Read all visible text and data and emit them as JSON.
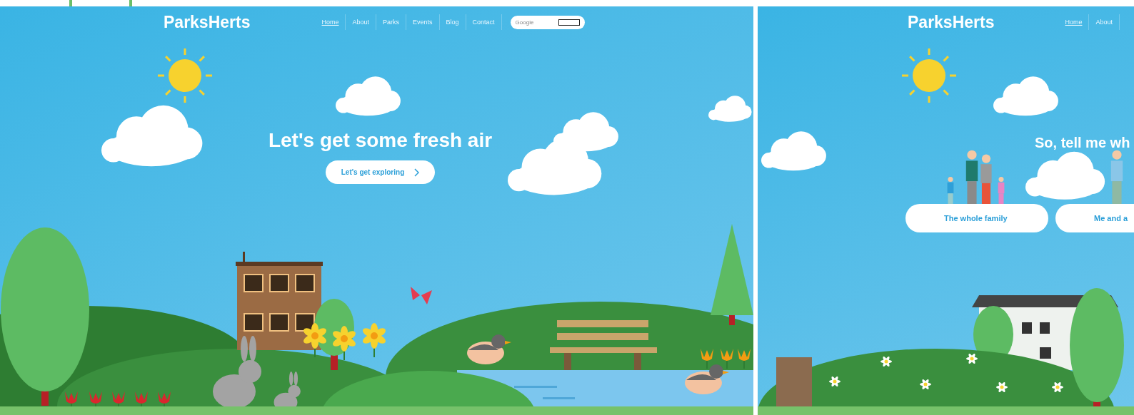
{
  "pages": [
    {
      "kind": "landing",
      "logo": "ParksHerts",
      "nav": [
        {
          "label": "Home",
          "selected": true
        },
        {
          "label": "About",
          "selected": false
        },
        {
          "label": "Parks",
          "selected": false
        },
        {
          "label": "Events",
          "selected": false
        },
        {
          "label": "Blog",
          "selected": false
        },
        {
          "label": "Contact",
          "selected": false
        }
      ],
      "search": {
        "placeholder": "Google"
      },
      "headline": "Let's get some fresh air",
      "buttons": [
        {
          "label": "Let's get exploring",
          "kind": "cta"
        }
      ]
    },
    {
      "kind": "chooser",
      "logo": "ParksHerts",
      "nav": [
        {
          "label": "Home",
          "selected": true
        },
        {
          "label": "About",
          "selected": false
        }
      ],
      "headline": "So, tell me wh",
      "buttons": [
        {
          "label": "The whole family",
          "kind": "choice"
        },
        {
          "label": "Me and a",
          "kind": "choice"
        }
      ]
    }
  ]
}
